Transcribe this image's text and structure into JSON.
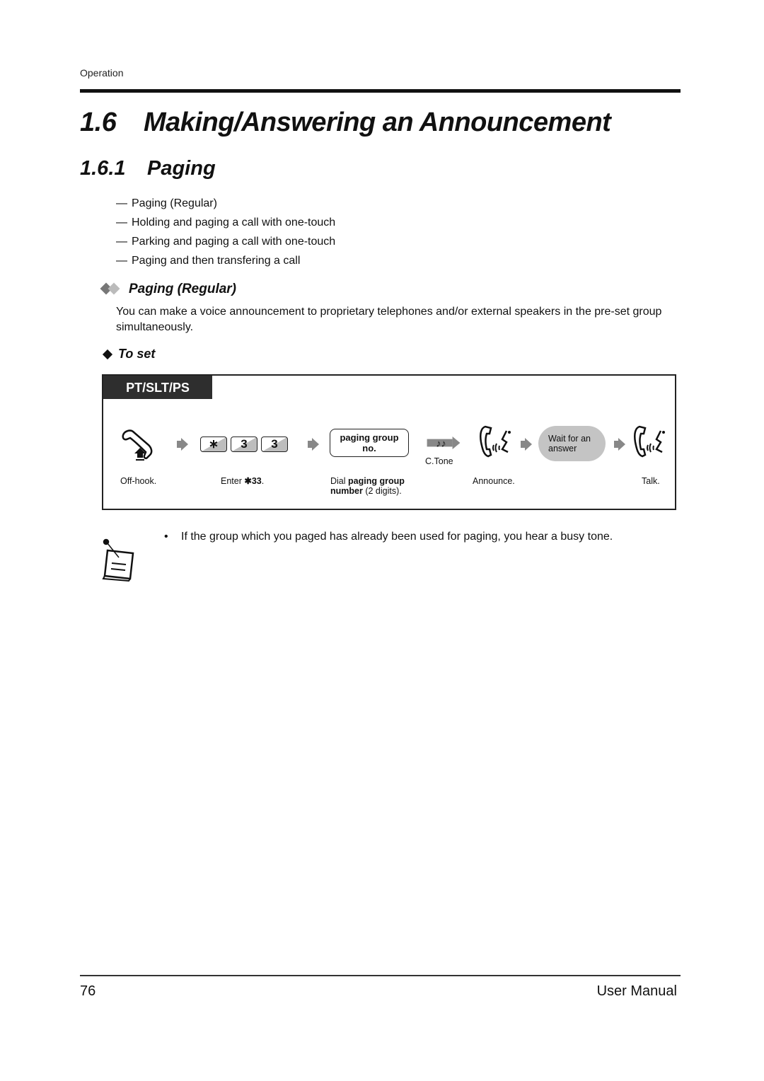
{
  "header": {
    "section_label": "Operation"
  },
  "heading1": {
    "number": "1.6",
    "title": "Making/Answering an Announcement"
  },
  "heading2": {
    "number": "1.6.1",
    "title": "Paging"
  },
  "toc": [
    {
      "dash": "—",
      "label": "Paging (Regular)"
    },
    {
      "dash": "—",
      "label": "Holding and paging a call with one-touch"
    },
    {
      "dash": "—",
      "label": "Parking and paging a call with one-touch"
    },
    {
      "dash": "—",
      "label": "Paging and then transfering a call"
    }
  ],
  "section": {
    "title": "Paging (Regular)",
    "description": "You can make a voice announcement to proprietary telephones and/or external speakers in the pre-set group simultaneously.",
    "subheading": "To set"
  },
  "procedure": {
    "device_tab": "PT/SLT/PS",
    "keys": [
      "∗",
      "3",
      "3"
    ],
    "paging_box": {
      "line1": "paging group",
      "line2": "no."
    },
    "tone_label": "C.Tone",
    "wait_pill": {
      "line1": "Wait for an",
      "line2": "answer"
    },
    "captions": {
      "offhook": "Off-hook.",
      "enter_prefix": "Enter ",
      "enter_code": "✱33",
      "enter_suffix": ".",
      "dial_prefix": "Dial ",
      "dial_bold1": "paging group",
      "dial_bold2": "number",
      "dial_suffix": " (2 digits).",
      "announce": "Announce.",
      "talk": "Talk."
    },
    "icons": [
      "handset-offhook-icon",
      "arrow-icon",
      "keypad-keys",
      "arrow-icon",
      "paging-group-box",
      "tone-arrow-icon",
      "handset-speaking-icon",
      "arrow-icon",
      "wait-pill",
      "arrow-icon",
      "handset-speaking-icon"
    ]
  },
  "note": {
    "bullet": "•",
    "text": "If the group which you paged has already been used for paging, you hear a busy tone."
  },
  "footer": {
    "page_number": "76",
    "title": "User Manual"
  }
}
